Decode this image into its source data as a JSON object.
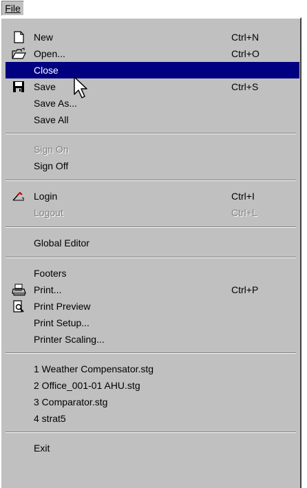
{
  "menubar": {
    "file_label": "File"
  },
  "menu": {
    "new": {
      "label": "New",
      "shortcut": "Ctrl+N"
    },
    "open": {
      "label": "Open...",
      "shortcut": "Ctrl+O"
    },
    "close": {
      "label": "Close"
    },
    "save": {
      "label": "Save",
      "shortcut": "Ctrl+S"
    },
    "save_as": {
      "label": "Save As..."
    },
    "save_all": {
      "label": "Save All"
    },
    "sign_on": {
      "label": "Sign On"
    },
    "sign_off": {
      "label": "Sign Off"
    },
    "login": {
      "label": "Login",
      "shortcut": "Ctrl+I"
    },
    "logout": {
      "label": "Logout",
      "shortcut": "Ctrl+L"
    },
    "global_editor": {
      "label": "Global Editor"
    },
    "footers": {
      "label": "Footers"
    },
    "print": {
      "label": "Print...",
      "shortcut": "Ctrl+P"
    },
    "print_preview": {
      "label": "Print Preview"
    },
    "print_setup": {
      "label": "Print Setup..."
    },
    "printer_scaling": {
      "label": "Printer Scaling..."
    },
    "recent": [
      {
        "label": "1 Weather Compensator.stg"
      },
      {
        "label": "2 Office_001-01 AHU.stg"
      },
      {
        "label": "3 Comparator.stg"
      },
      {
        "label": "4 strat5"
      }
    ],
    "exit": {
      "label": "Exit"
    }
  },
  "colors": {
    "menu_bg": "#c0c0c0",
    "highlight": "#000080",
    "disabled_text": "#808080"
  },
  "icons": {
    "new": "new-document-icon",
    "open": "open-folder-icon",
    "save": "floppy-disk-icon",
    "login": "login-pen-icon",
    "print": "printer-icon",
    "print_preview": "print-preview-icon",
    "cursor": "mouse-pointer-icon"
  }
}
